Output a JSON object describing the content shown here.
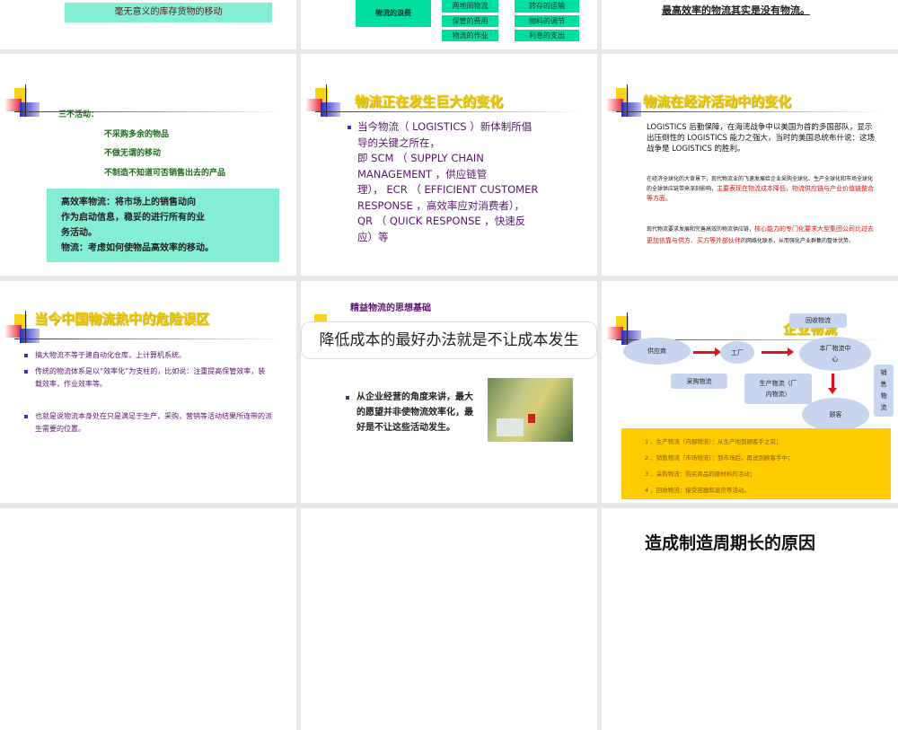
{
  "slides": [
    {
      "box_text": "毫无意义的库存货物的移动"
    },
    {
      "main": "物流的浪费",
      "items": [
        "两地间物流",
        "转存的运输",
        "保管的费用",
        "物料的调节",
        "物流的作业",
        "利息的支出"
      ]
    },
    {
      "text": "最高效率的物流其实是没有物流。"
    },
    {
      "heading": "三不活动：",
      "items": [
        "不采购多余的物品",
        "不做无谓的移动",
        "不制造不知道可否销售出去的产品"
      ],
      "box_lines": [
        "高效率物流：将市场上的销售动向",
        "作为启动信息，稳妥的进行所有的业",
        "务活动。",
        "物流：考虑如何使物品高效率的移动。"
      ]
    },
    {
      "title": "物流正在发生巨大的变化",
      "lines": [
        "当今物流（ LOGISTICS ）新体制所倡",
        "导的关键之所在，",
        "即 SCM （ SUPPLY CHAIN",
        "MANAGEMENT ，供应链管",
        "理）， ECR （ EFFICIENT CUSTOMER",
        "RESPONSE ，高效率应对消费者），",
        "QR （ QUICK RESPONSE ，快速反",
        "应）等"
      ]
    },
    {
      "title": "物流在经济活动中的变化",
      "p1": "LOGISTICS 后勤保障，在海湾战争中以美国为首的多国部队，显示出压倒性的 LOGISTICS 能力之强大，当时的美国总统布什说：这场战争是 LOGISTICS 的胜利。",
      "p2_black": "在经济全球化的大背景下，现代物流业的飞速发展给企业采购全球化、生产全球化和市场全球化的全球供应链带来深刻影响，",
      "p2_red": "主要表现在物流成本降低，物流供应链与产业价值链整合等方面。",
      "p3_black": "现代物流要求发展和完善高效的物流供应链，",
      "p3_red": "核心能力的专门化要求大型集团公司比过去更加依靠与供方、买方等外部伙伴",
      "p3_black2": "的网络化联系，从而强化产业群集的整体优势。"
    },
    {
      "title": "当今中国物流热中的危险误区",
      "bullets": [
        "搞大物流不等于建自动化仓库，上计算机系统。",
        "传统的物流体系是以“效率化”为支柱的，比如说：注重提高保管效率，装载效率，作业效率等。",
        "也就是说物流本身处在只是满足于生产，采购，营销等活动结果所连带的派生需要的位置。"
      ]
    },
    {
      "title": "精益物流的思想基础",
      "banner": "降低成本的最好办法就是不让成本发生",
      "bullet": "从企业经营的角度来讲，最大的愿望并非使物流效率化，最好是不让这些活动发生。"
    },
    {
      "title": "企业物流",
      "nodes": {
        "supplier": "供应商",
        "factory": "工厂",
        "center": "本厂物流中心",
        "customer": "顾客"
      },
      "callouts": {
        "recycle": "回收物流",
        "purchase": "采购物流",
        "production": "生产物流（厂内物流）",
        "sales": "销售物流"
      },
      "notes": [
        "1 、生产物流（内部物流）：从生产地到顾客手之前；",
        "2 、销售物流（市场物流）：到市场后，再送到顾客手中；",
        "3 、采购物流：购买商品的原材料的活动；",
        "4 、回收物流：接受容器和退货等活动。"
      ]
    },
    {},
    {},
    {
      "title": "造成制造周期长的原因"
    }
  ]
}
